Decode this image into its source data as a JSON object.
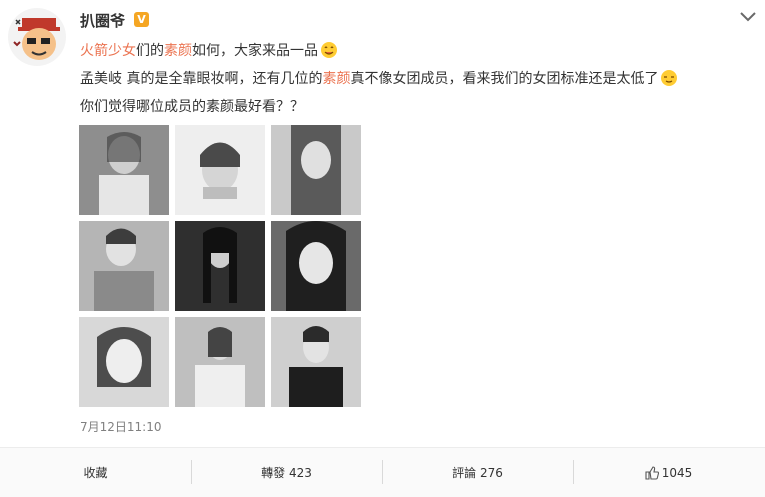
{
  "post": {
    "author": "扒圈爷",
    "verified_badge": "V",
    "line1": {
      "p1": "火箭少女",
      "p2": "们的",
      "p3": "素颜",
      "p4": "如何，大家来品一品"
    },
    "line2": {
      "p1": "孟美岐 真的是全靠眼妆啊，还有几位的",
      "p2": "素颜",
      "p3": "真不像女团成员，看来我们的女团标准还是太低了"
    },
    "line3": "你们觉得哪位成员的素颜最好看？？",
    "timestamp": "7月12日11:10",
    "photo_count": 9
  },
  "actions": {
    "favorite": "收藏",
    "repost": "轉發 423",
    "comment": "評論 276",
    "like_count": "1045"
  },
  "icons": {
    "menu": "chevron-down-icon",
    "emoji1": "yum-emoji-icon",
    "emoji2": "relieved-emoji-icon",
    "like": "thumbs-up-icon"
  },
  "colors": {
    "highlight": "#eb7350",
    "badge": "#f5a623"
  }
}
